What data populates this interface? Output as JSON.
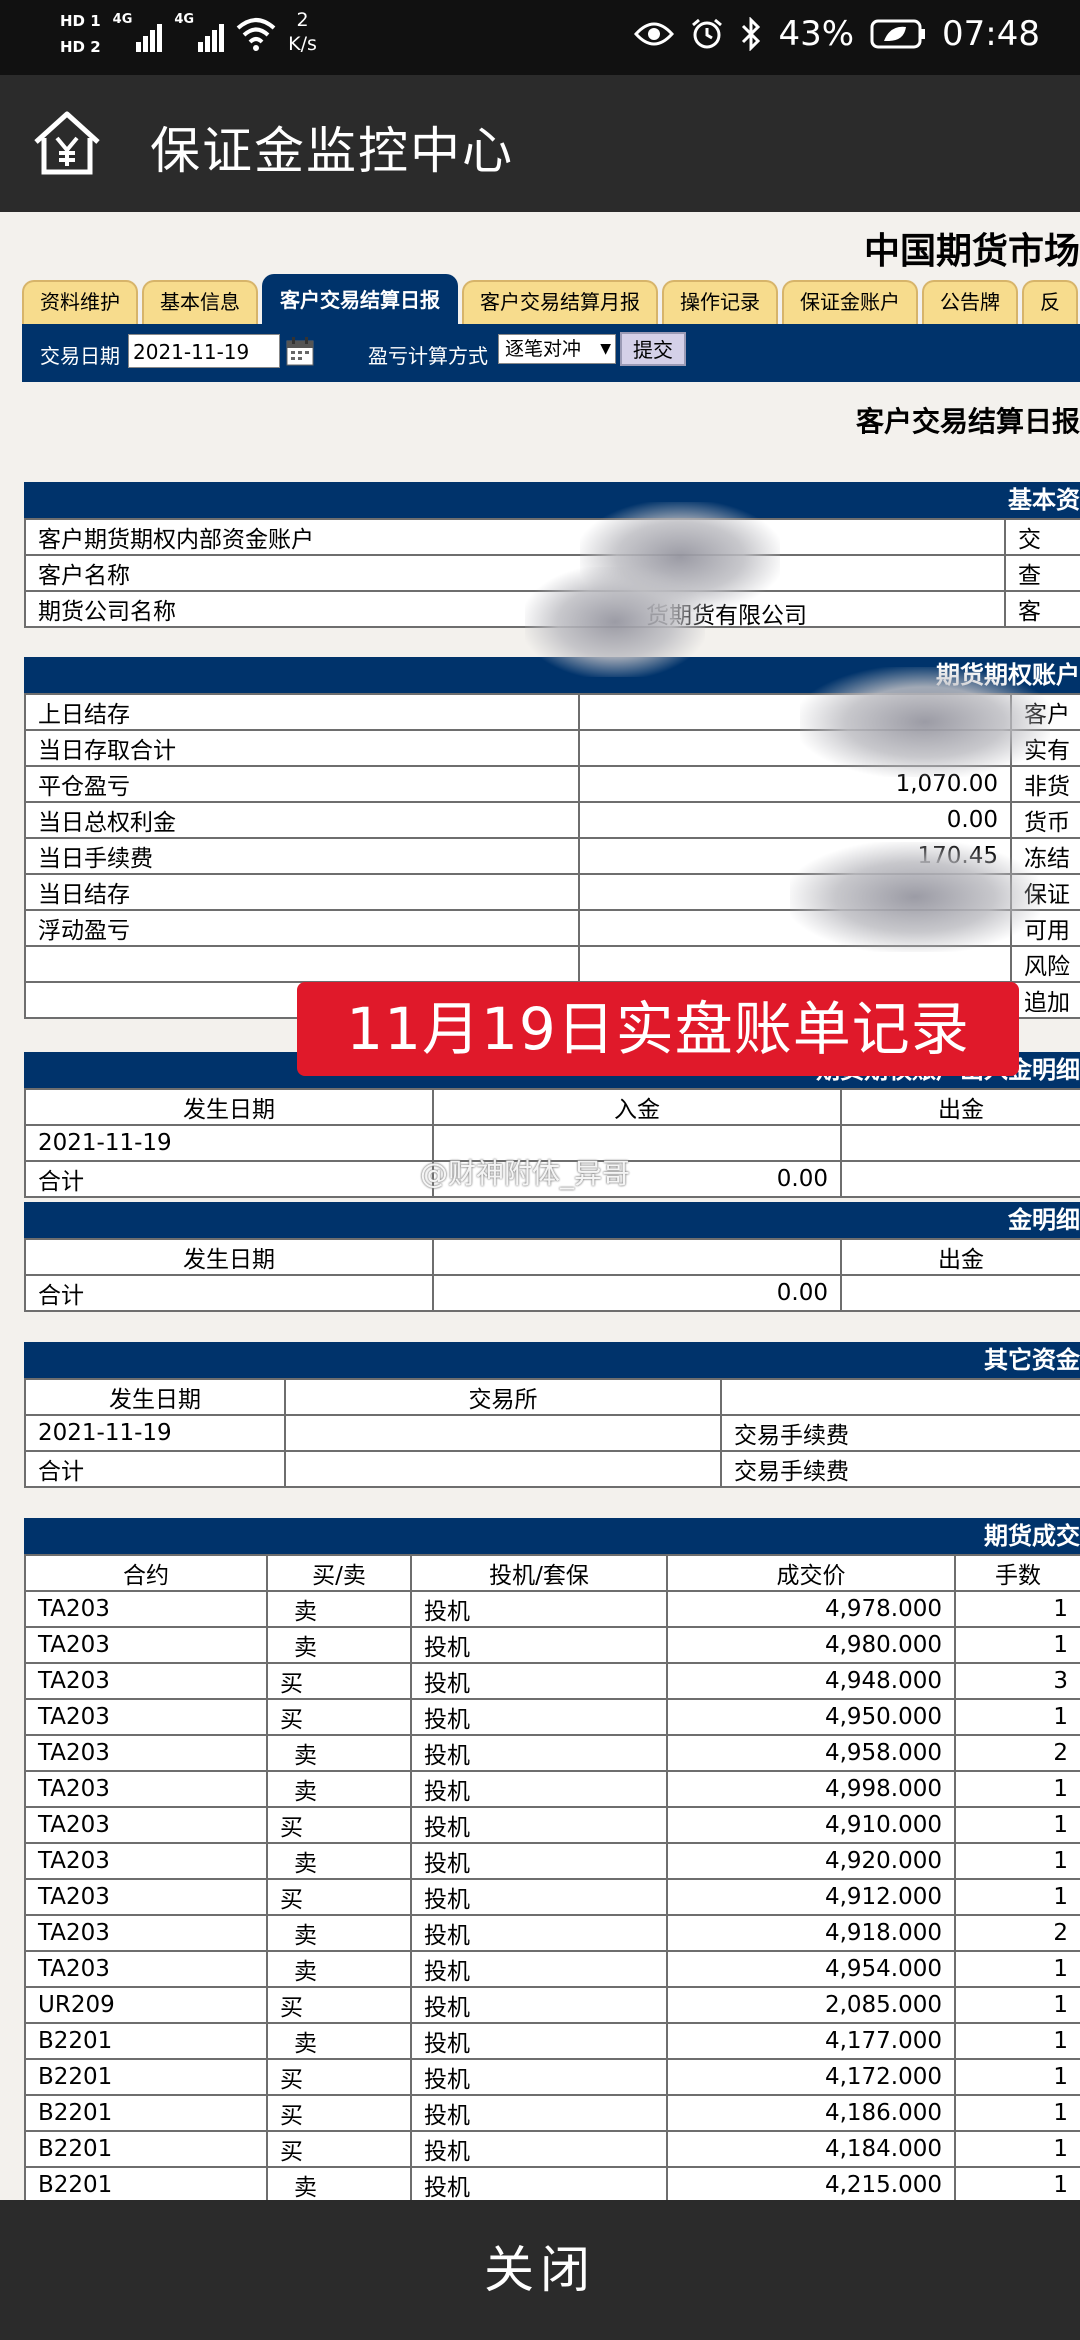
{
  "status_bar": {
    "hd1": "HD 1",
    "hd2": "HD 2",
    "net1": "4G",
    "net2": "4G",
    "speed_value": "2",
    "speed_unit": "K/s",
    "battery": "43%",
    "time": "07:48",
    "icons": [
      "eye-icon",
      "alarm-icon",
      "bluetooth-icon",
      "battery-icon"
    ]
  },
  "app_bar": {
    "title": "保证金监控中心",
    "home_icon": "home-yen-icon"
  },
  "page": {
    "header": "中国期货市场",
    "tabs": [
      {
        "label": "资料维护",
        "active": false
      },
      {
        "label": "基本信息",
        "active": false
      },
      {
        "label": "客户交易结算日报",
        "active": true
      },
      {
        "label": "客户交易结算月报",
        "active": false
      },
      {
        "label": "操作记录",
        "active": false
      },
      {
        "label": "保证金账户",
        "active": false
      },
      {
        "label": "公告牌",
        "active": false
      },
      {
        "label": "反",
        "active": false
      }
    ],
    "filter": {
      "date_label": "交易日期",
      "date_value": "2021-11-19",
      "method_label": "盈亏计算方式",
      "method_value": "逐笔对冲",
      "submit_label": "提交"
    },
    "report_title": "客户交易结算日报"
  },
  "basic_info": {
    "header": "基本资",
    "rows": [
      {
        "label": "客户期货期权内部资金账户",
        "value": "",
        "right": "交"
      },
      {
        "label": "客户名称",
        "value": "",
        "right": "查"
      },
      {
        "label": "期货公司名称",
        "value": "货期货有限公司",
        "right": "客"
      }
    ]
  },
  "account_summary": {
    "header": "期货期权账户",
    "rows": [
      {
        "label": "上日结存",
        "value": "",
        "right": "客户"
      },
      {
        "label": "当日存取合计",
        "value": "",
        "right": "实有"
      },
      {
        "label": "平仓盈亏",
        "value": "1,070.00",
        "right": "非货"
      },
      {
        "label": "当日总权利金",
        "value": "0.00",
        "right": "货币"
      },
      {
        "label": "当日手续费",
        "value": "170.45",
        "right": "冻结"
      },
      {
        "label": "当日结存",
        "value": "",
        "right": "保证"
      },
      {
        "label": "浮动盈亏",
        "value": "",
        "right": "可用"
      },
      {
        "label": "",
        "value": "",
        "right": "风险"
      },
      {
        "label": "",
        "value": "",
        "right": "追加"
      }
    ]
  },
  "cash_flow": {
    "header": "期货期权账户出入金明细",
    "columns": [
      "发生日期",
      "入金",
      "出金"
    ],
    "rows": [
      {
        "date": "2021-11-19",
        "in": "",
        "out": ""
      },
      {
        "date": "合计",
        "in": "0.00",
        "out": ""
      }
    ]
  },
  "cash_flow2": {
    "header": "金明细",
    "columns": [
      "发生日期",
      "",
      "出金"
    ],
    "rows": [
      {
        "date": "合计",
        "in": "0.00",
        "out": ""
      }
    ]
  },
  "other_funds": {
    "header": "其它资金",
    "columns": [
      "发生日期",
      "交易所",
      ""
    ],
    "rows": [
      {
        "date": "2021-11-19",
        "exchange": "",
        "type": "交易手续费"
      },
      {
        "date": "合计",
        "exchange": "",
        "type": "交易手续费"
      }
    ]
  },
  "trades": {
    "header": "期货成交",
    "columns": [
      "合约",
      "买/卖",
      "投机/套保",
      "成交价",
      "手数"
    ],
    "rows": [
      {
        "contract": "TA203",
        "side": "卖",
        "type": "投机",
        "price": "4,978.000",
        "qty": "1"
      },
      {
        "contract": "TA203",
        "side": "卖",
        "type": "投机",
        "price": "4,980.000",
        "qty": "1"
      },
      {
        "contract": "TA203",
        "side": "买",
        "type": "投机",
        "price": "4,948.000",
        "qty": "3"
      },
      {
        "contract": "TA203",
        "side": "买",
        "type": "投机",
        "price": "4,950.000",
        "qty": "1"
      },
      {
        "contract": "TA203",
        "side": "卖",
        "type": "投机",
        "price": "4,958.000",
        "qty": "2"
      },
      {
        "contract": "TA203",
        "side": "卖",
        "type": "投机",
        "price": "4,998.000",
        "qty": "1"
      },
      {
        "contract": "TA203",
        "side": "买",
        "type": "投机",
        "price": "4,910.000",
        "qty": "1"
      },
      {
        "contract": "TA203",
        "side": "卖",
        "type": "投机",
        "price": "4,920.000",
        "qty": "1"
      },
      {
        "contract": "TA203",
        "side": "买",
        "type": "投机",
        "price": "4,912.000",
        "qty": "1"
      },
      {
        "contract": "TA203",
        "side": "卖",
        "type": "投机",
        "price": "4,918.000",
        "qty": "2"
      },
      {
        "contract": "TA203",
        "side": "卖",
        "type": "投机",
        "price": "4,954.000",
        "qty": "1"
      },
      {
        "contract": "UR209",
        "side": "买",
        "type": "投机",
        "price": "2,085.000",
        "qty": "1"
      },
      {
        "contract": "B2201",
        "side": "卖",
        "type": "投机",
        "price": "4,177.000",
        "qty": "1"
      },
      {
        "contract": "B2201",
        "side": "买",
        "type": "投机",
        "price": "4,172.000",
        "qty": "1"
      },
      {
        "contract": "B2201",
        "side": "买",
        "type": "投机",
        "price": "4,186.000",
        "qty": "1"
      },
      {
        "contract": "B2201",
        "side": "买",
        "type": "投机",
        "price": "4,184.000",
        "qty": "1"
      },
      {
        "contract": "B2201",
        "side": "卖",
        "type": "投机",
        "price": "4,215.000",
        "qty": "1"
      }
    ]
  },
  "overlay": {
    "banner": "11月19日实盘账单记录",
    "watermark": "@财神附体_异哥"
  },
  "bottom": {
    "close_label": "关闭"
  }
}
